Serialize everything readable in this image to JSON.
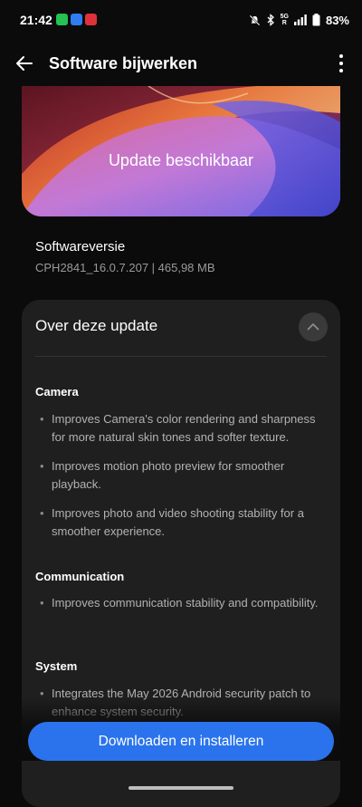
{
  "status_bar": {
    "time": "21:42",
    "notification_icons": [
      "whatsapp-icon",
      "app-icon",
      "vpn-icon"
    ],
    "network": "5G",
    "battery_percent": "83%"
  },
  "app_bar": {
    "title": "Software bijwerken",
    "back_icon": "arrow-left-icon",
    "menu_icon": "more-vert-icon"
  },
  "banner": {
    "text": "Update beschikbaar"
  },
  "software_version": {
    "label": "Softwareversie",
    "value": "CPH2841_16.0.7.207 | 465,98 MB"
  },
  "update_card": {
    "title": "Over deze update",
    "collapse_icon": "chevron-up-icon",
    "sections": [
      {
        "title": "Camera",
        "items": [
          "Improves Camera's color rendering and sharpness for more natural skin tones and softer texture.",
          "Improves motion photo preview for smoother playback.",
          "Improves photo and video shooting stability for a smoother experience."
        ]
      },
      {
        "title": "Communication",
        "items": [
          "Improves communication stability and compatibility."
        ]
      },
      {
        "title": "System",
        "items": [
          "Integrates the May 2026 Android security patch to enhance system security."
        ]
      }
    ]
  },
  "actions": {
    "download_label": "Downloaden en installeren"
  },
  "colors": {
    "background": "#0b0b0b",
    "card": "#1f1f1f",
    "accent": "#2a73ec",
    "secondary_text": "#9a9a9a"
  }
}
